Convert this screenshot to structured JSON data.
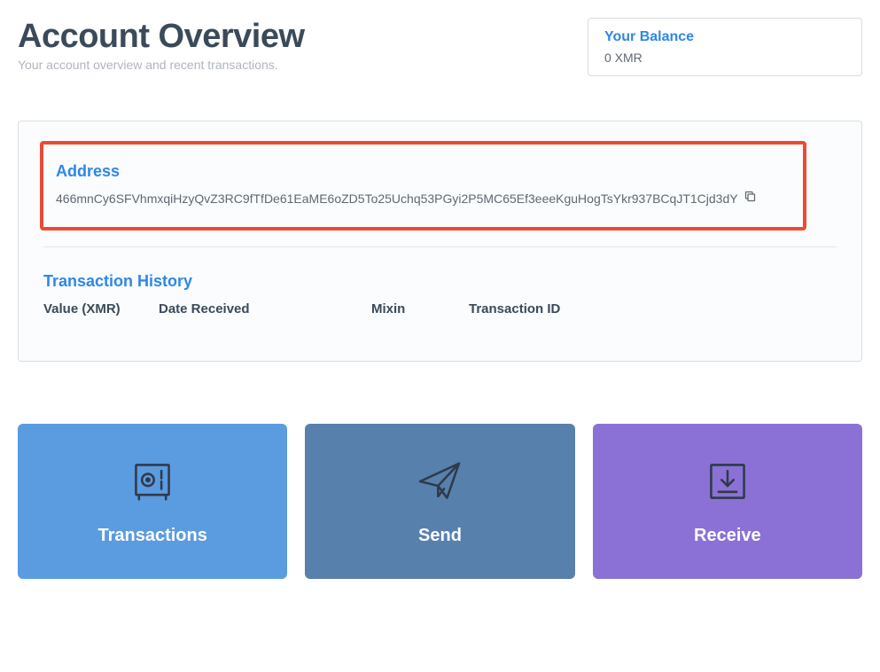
{
  "header": {
    "title": "Account Overview",
    "subtitle": "Your account overview and recent transactions."
  },
  "balance": {
    "label": "Your Balance",
    "value": "0 XMR"
  },
  "address": {
    "label": "Address",
    "value": "466mnCy6SFVhmxqiHzyQvZ3RC9fTfDe61EaME6oZD5To25Uchq53PGyi2P5MC65Ef3eeeKguHogTsYkr937BCqJT1Cjd3dY"
  },
  "transactions": {
    "label": "Transaction History",
    "columns": {
      "value": "Value (XMR)",
      "date": "Date Received",
      "mixin": "Mixin",
      "txid": "Transaction ID"
    }
  },
  "actions": {
    "transactions": "Transactions",
    "send": "Send",
    "receive": "Receive"
  }
}
